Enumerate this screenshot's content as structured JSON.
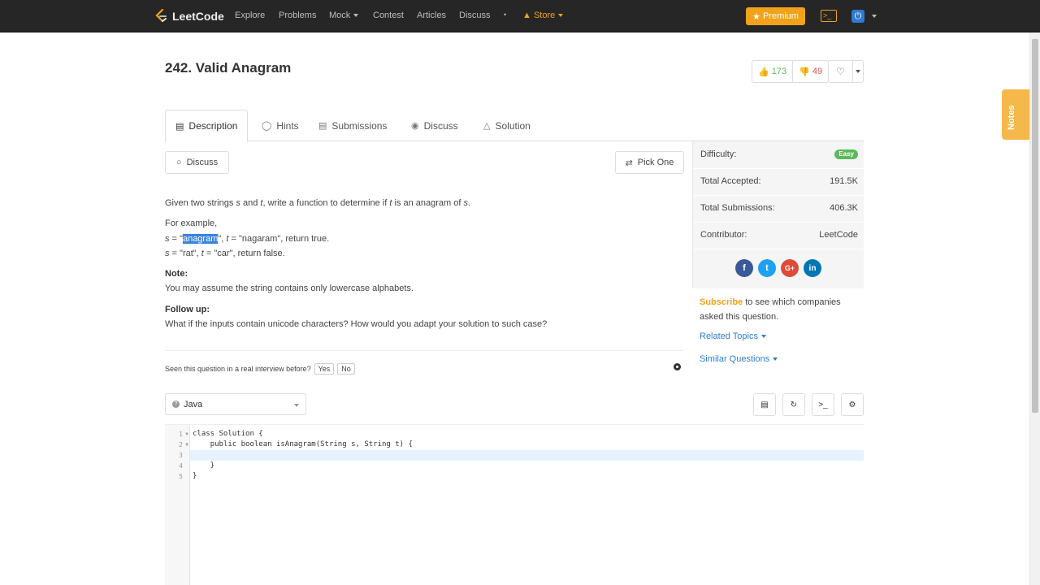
{
  "nav": {
    "brand": "LeetCode",
    "links": [
      "Explore",
      "Problems",
      "Mock",
      "Contest",
      "Articles",
      "Discuss"
    ],
    "dot": "•",
    "store": "Store",
    "premium": "Premium"
  },
  "notes_tab": "Notes",
  "problem": {
    "title": "242. Valid Anagram",
    "upvotes": "173",
    "downvotes": "49"
  },
  "tabs": [
    "Description",
    "Hints",
    "Submissions",
    "Discuss",
    "Solution"
  ],
  "desc": {
    "discuss_btn": "Discuss",
    "pick_one": "Pick One",
    "intro_a": "Given two strings ",
    "intro_s": "s",
    "intro_b": " and ",
    "intro_t": "t",
    "intro_c": ", write a function to determine if ",
    "intro_t2": "t",
    "intro_d": " is an anagram of ",
    "intro_s2": "s",
    "intro_e": ".",
    "for_example": "For example,",
    "ex1_s": "s",
    "ex1_a": " = \"",
    "ex1_hl": "anagram",
    "ex1_b": "\", ",
    "ex1_t": "t",
    "ex1_c": " = \"nagaram\", return true.",
    "ex2_s": "s",
    "ex2_a": " = \"rat\", ",
    "ex2_t": "t",
    "ex2_b": " = \"car\", return false.",
    "note_label": "Note:",
    "note_text": "You may assume the string contains only lowercase alphabets.",
    "follow_label": "Follow up:",
    "follow_text": "What if the inputs contain unicode characters? How would you adapt your solution to such case?",
    "interview_q": "Seen this question in a real interview before?",
    "yes": "Yes",
    "no": "No"
  },
  "sidebar": {
    "difficulty_label": "Difficulty:",
    "difficulty_value": "Easy",
    "accepted_label": "Total Accepted:",
    "accepted_value": "191.5K",
    "submissions_label": "Total Submissions:",
    "submissions_value": "406.3K",
    "contributor_label": "Contributor:",
    "contributor_value": "LeetCode",
    "subscribe": "Subscribe",
    "subscribe_rest": " to see which companies asked this question.",
    "related_topics": "Related Topics",
    "similar_questions": "Similar Questions"
  },
  "editor": {
    "language": "Java",
    "line_numbers": [
      "1",
      "2",
      "3",
      "4",
      "5"
    ],
    "lines": [
      "class Solution {",
      "    public boolean isAnagram(String s, String t) {",
      "        ",
      "    }",
      "}"
    ]
  },
  "colors": {
    "navbar": "#262626",
    "accent_orange": "#f0a21b",
    "link_blue": "#2f7bd1",
    "easy_green": "#5cb85c",
    "downvote_red": "#d9534f"
  }
}
